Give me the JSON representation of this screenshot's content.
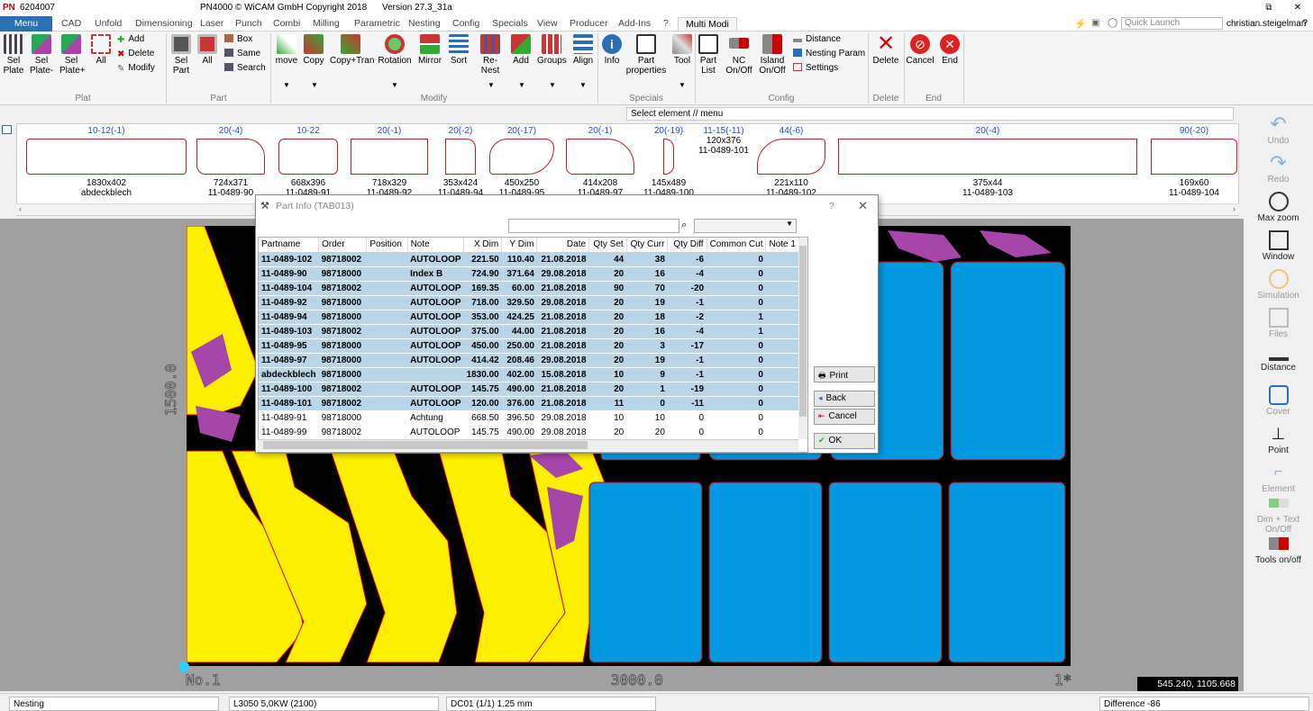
{
  "titlebar": {
    "app_id": "6204007",
    "copyright": "PN4000 © WiCAM GmbH Copyright 2018",
    "version": "Version 27.3_31a",
    "user": "christian.steigelman",
    "quick_launch_placeholder": "Quick Launch"
  },
  "tabs": [
    "Menu",
    "CAD",
    "Unfold",
    "Dimensioning",
    "Laser",
    "Punch",
    "Combi",
    "Milling",
    "Parametric",
    "Nesting",
    "Config",
    "Specials",
    "View",
    "Producer",
    "Add-Ins",
    "?",
    "Multi Modi"
  ],
  "ribbon": {
    "plat": {
      "group": "Plat",
      "sel_plate": "Sel\nPlate",
      "sel_plate_minus": "Sel\nPlate-",
      "sel_plate_plus": "Sel\nPlate+",
      "all": "All",
      "add": "Add",
      "delete": "Delete",
      "modify": "Modify"
    },
    "part": {
      "group": "Part",
      "sel_part": "Sel\nPart",
      "all": "All",
      "box": "Box",
      "same": "Same",
      "search": "Search"
    },
    "modify": {
      "group": "Modify",
      "items": [
        "move",
        "Copy",
        "Copy+Tran",
        "Rotation",
        "Mirror",
        "Sort",
        "Re-Nest",
        "Add",
        "Groups",
        "Align"
      ]
    },
    "specials": {
      "group": "Specials",
      "info": "Info",
      "part_properties": "Part\nproperties",
      "tool": "Tool"
    },
    "config": {
      "group": "Config",
      "part_list": "Part\nList",
      "nc": "NC\nOn/Off",
      "island": "Island\nOn/Off",
      "distance": "Distance",
      "nesting_param": "Nesting Param",
      "settings": "Settings"
    },
    "delete": {
      "group": "Delete",
      "label": "Delete"
    },
    "end": {
      "group": "End",
      "cancel": "Cancel",
      "end": "End"
    }
  },
  "status_prompt": "Select element // menu",
  "parts": [
    {
      "top": "10-12(-1)",
      "dim": "1830x402",
      "name": "abdeckblech"
    },
    {
      "top": "20(-4)",
      "dim": "724x371",
      "name": "11-0489-90"
    },
    {
      "top": "10-22",
      "dim": "668x396",
      "name": "11-0489-91"
    },
    {
      "top": "20(-1)",
      "dim": "718x329",
      "name": "11-0489-92"
    },
    {
      "top": "20(-2)",
      "dim": "353x424",
      "name": "11-0489-94"
    },
    {
      "top": "20(-17)",
      "dim": "450x250",
      "name": "11-0489-95"
    },
    {
      "top": "20(-1)",
      "dim": "414x208",
      "name": "11-0489-97"
    },
    {
      "top": "20(-19)",
      "dim": "145x489",
      "name": "11-0489-100"
    },
    {
      "top": "11-15(-11)",
      "dim": "120x376",
      "name": "11-0489-101"
    },
    {
      "top": "44(-6)",
      "dim": "221x110",
      "name": "11-0489-102"
    },
    {
      "top": "20(-4)",
      "dim": "375x44",
      "name": "11-0489-103"
    },
    {
      "top": "90(-20)",
      "dim": "169x60",
      "name": "11-0489-104"
    }
  ],
  "dialog": {
    "title": "Part Info (TAB013)",
    "help": "?",
    "columns": [
      "Partname",
      "Order",
      "Position",
      "Note",
      "X Dim",
      "Y Dim",
      "Date",
      "Qty Set",
      "Qty Curr",
      "Qty Diff",
      "Common Cut",
      "Note 1"
    ],
    "rows": [
      {
        "sel": true,
        "c": [
          "11-0489-102",
          "98718002",
          "",
          "AUTOLOOP",
          "221.50",
          "110.40",
          "21.08.2018",
          "44",
          "38",
          "-6",
          "0",
          ""
        ]
      },
      {
        "sel": true,
        "c": [
          "11-0489-90",
          "98718000",
          "",
          "Index B",
          "724.90",
          "371.64",
          "29.08.2018",
          "20",
          "16",
          "-4",
          "0",
          ""
        ]
      },
      {
        "sel": true,
        "c": [
          "11-0489-104",
          "98718002",
          "",
          "AUTOLOOP",
          "169.35",
          "60.00",
          "21.08.2018",
          "90",
          "70",
          "-20",
          "0",
          ""
        ]
      },
      {
        "sel": true,
        "c": [
          "11-0489-92",
          "98718000",
          "",
          "AUTOLOOP",
          "718.00",
          "329.50",
          "29.08.2018",
          "20",
          "19",
          "-1",
          "0",
          ""
        ]
      },
      {
        "sel": true,
        "c": [
          "11-0489-94",
          "98718000",
          "",
          "AUTOLOOP",
          "353.00",
          "424.25",
          "21.08.2018",
          "20",
          "18",
          "-2",
          "1",
          ""
        ]
      },
      {
        "sel": true,
        "c": [
          "11-0489-103",
          "98718002",
          "",
          "AUTOLOOP",
          "375.00",
          "44.00",
          "21.08.2018",
          "20",
          "16",
          "-4",
          "1",
          ""
        ]
      },
      {
        "sel": true,
        "c": [
          "11-0489-95",
          "98718000",
          "",
          "AUTOLOOP",
          "450.00",
          "250.00",
          "21.08.2018",
          "20",
          "3",
          "-17",
          "0",
          ""
        ]
      },
      {
        "sel": true,
        "c": [
          "11-0489-97",
          "98718000",
          "",
          "AUTOLOOP",
          "414.42",
          "208.46",
          "29.08.2018",
          "20",
          "19",
          "-1",
          "0",
          ""
        ]
      },
      {
        "sel": true,
        "c": [
          "abdeckblech",
          "98718000",
          "",
          "",
          "1830.00",
          "402.00",
          "15.08.2018",
          "10",
          "9",
          "-1",
          "0",
          ""
        ]
      },
      {
        "sel": true,
        "c": [
          "11-0489-100",
          "98718002",
          "",
          "AUTOLOOP",
          "145.75",
          "490.00",
          "21.08.2018",
          "20",
          "1",
          "-19",
          "0",
          ""
        ]
      },
      {
        "sel": true,
        "c": [
          "11-0489-101",
          "98718002",
          "",
          "AUTOLOOP",
          "120.00",
          "376.00",
          "21.08.2018",
          "11",
          "0",
          "-11",
          "0",
          ""
        ]
      },
      {
        "sel": false,
        "c": [
          "11-0489-91",
          "98718000",
          "",
          "Achtung",
          "668.50",
          "396.50",
          "29.08.2018",
          "10",
          "10",
          "0",
          "0",
          ""
        ]
      },
      {
        "sel": false,
        "c": [
          "11-0489-99",
          "98718002",
          "",
          "AUTOLOOP",
          "145.75",
          "490.00",
          "29.08.2018",
          "20",
          "20",
          "0",
          "0",
          ""
        ]
      }
    ],
    "buttons": {
      "print": "Print",
      "back": "Back",
      "cancel": "Cancel",
      "ok": "OK"
    }
  },
  "right_panel": [
    "Undo",
    "Redo",
    "Max zoom",
    "Window",
    "Simulation",
    "Files",
    "Distance",
    "Cover",
    "Point",
    "Element",
    "Dim + Text On/Off",
    "Tools on/off"
  ],
  "axis": {
    "y": "1500.0",
    "x": "3000.0",
    "no": "No.1",
    "one": "1*"
  },
  "coords": "545.240, 1105.668",
  "statusbar": {
    "mode": "Nesting",
    "machine": "L3050  5,0KW   (2100)",
    "dc": "DC01   (1/1)   1.25 mm",
    "difference": "Difference -86"
  },
  "colors": {
    "yellow": "#ffef00",
    "blue": "#0098e0",
    "purple": "#a646a8",
    "accent": "#2b6fb5"
  }
}
